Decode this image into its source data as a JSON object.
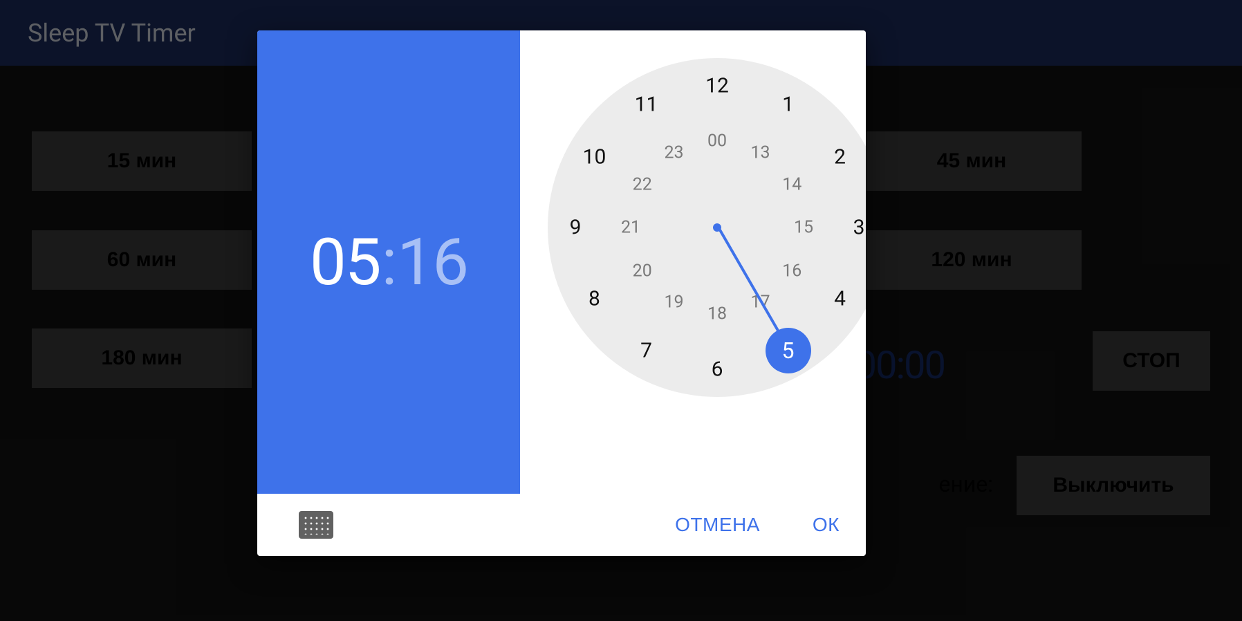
{
  "app": {
    "title": "Sleep TV Timer",
    "presets": {
      "p15": "15 мин",
      "p45": "45 мин",
      "p60": "60 мин",
      "p120": "120 мин",
      "p180": "180 мин"
    },
    "countdown_partial": "00:00",
    "stop_label": "стоп",
    "off_suffix": "ение:",
    "off_button": "Выключить"
  },
  "picker": {
    "hours": "05",
    "separator": ":",
    "minutes": "16",
    "selected_hour": 5,
    "cancel": "ОТМЕНА",
    "ok": "ОК",
    "outer_ring": [
      "12",
      "1",
      "2",
      "3",
      "4",
      "5",
      "6",
      "7",
      "8",
      "9",
      "10",
      "11"
    ],
    "inner_ring": [
      "00",
      "13",
      "14",
      "15",
      "16",
      "17",
      "18",
      "19",
      "20",
      "21",
      "22",
      "23"
    ]
  }
}
